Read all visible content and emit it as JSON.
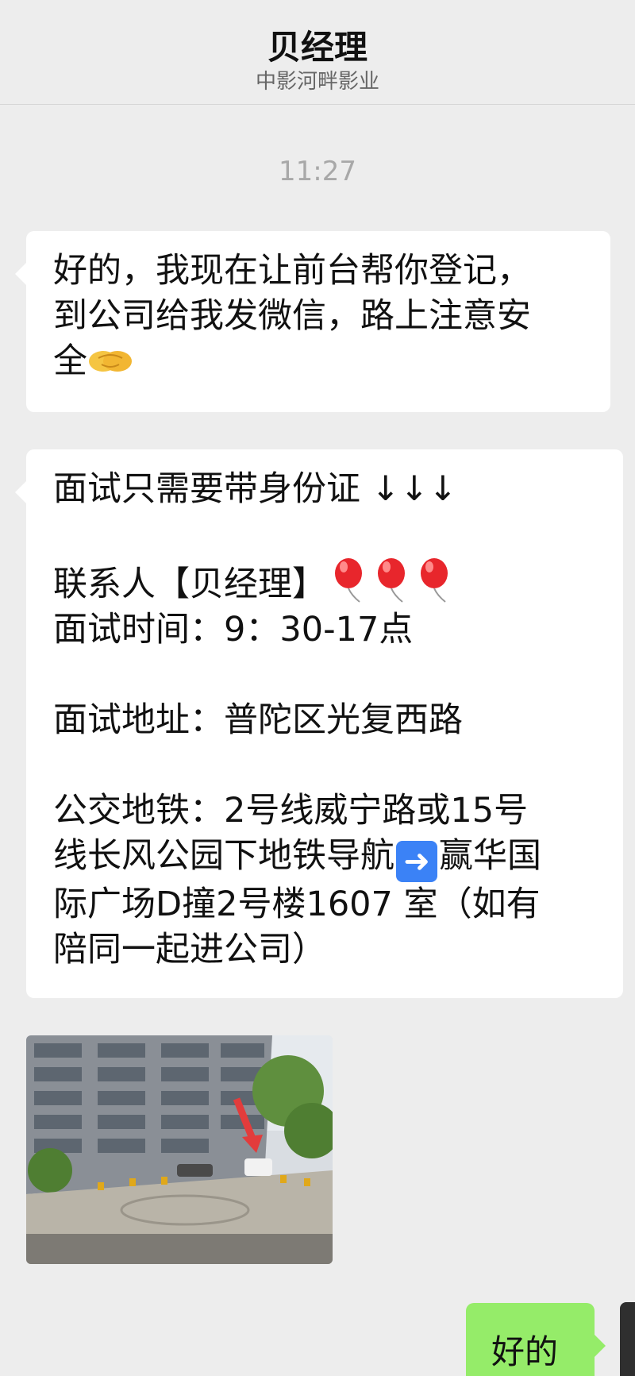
{
  "header": {
    "title": "贝经理",
    "subtitle": "中影河畔影业"
  },
  "chat": {
    "time": "11:27",
    "message1": {
      "line1": "好的，我现在让前台帮你登记，",
      "line2": "到公司给我发微信，路上注意安",
      "line3": "全",
      "emoji": "handshake-emoji"
    },
    "message2": {
      "line1": "面试只需要带身份证 ↓↓↓",
      "contact": "联系人【贝经理】",
      "time_line": "面试时间：9：30-17点",
      "address": "面试地址：普陀区光复西路",
      "transit1": "公交地铁：2号线威宁路或15号",
      "transit2a": "线长风公园下地铁导航",
      "transit2b": "赢华国",
      "transit3": "际广场D撞2号楼1607 室（如有",
      "transit4": "陪同一起进公司）",
      "balloon_emoji": "balloon-emoji",
      "arrow_emoji": "right-arrow-emoji",
      "arrow_glyph": "➜"
    },
    "photo": {
      "description_icon": "building-photo"
    },
    "reply": {
      "text": "好的"
    }
  },
  "colors": {
    "background": "#ededed",
    "incoming_bubble": "#ffffff",
    "outgoing_bubble": "#95ec69",
    "time_text": "#a8a8a8"
  }
}
